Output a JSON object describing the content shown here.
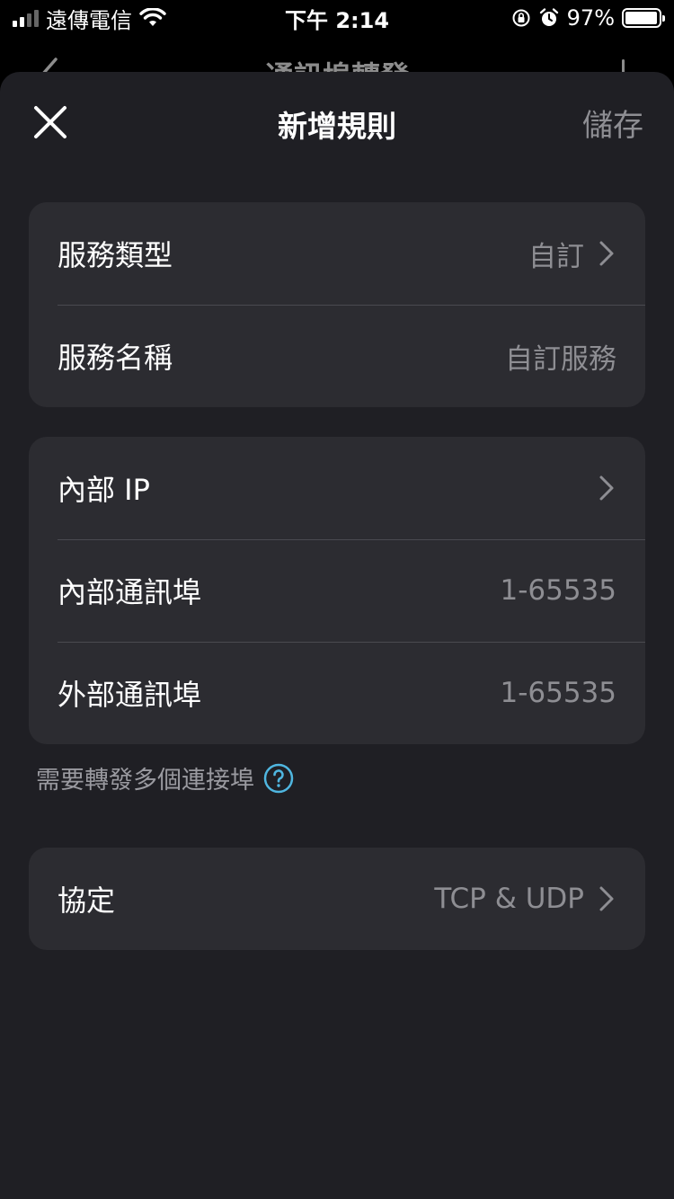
{
  "status_bar": {
    "carrier": "遠傳電信",
    "time": "下午 2:14",
    "battery_percent": "97%",
    "battery_level": 0.97
  },
  "background_page": {
    "title": "通訊埠轉發"
  },
  "sheet": {
    "title": "新增規則",
    "save_label": "儲存"
  },
  "service_group": {
    "type_label": "服務類型",
    "type_value": "自訂",
    "name_label": "服務名稱",
    "name_placeholder": "自訂服務"
  },
  "ip_group": {
    "internal_ip_label": "內部 IP",
    "internal_port_label": "內部通訊埠",
    "internal_port_placeholder": "1-65535",
    "external_port_label": "外部通訊埠",
    "external_port_placeholder": "1-65535"
  },
  "hint": {
    "text": "需要轉發多個連接埠"
  },
  "protocol_group": {
    "label": "協定",
    "value": "TCP & UDP"
  },
  "colors": {
    "sheet_bg": "#1f1f24",
    "card_bg": "#2c2c31",
    "secondary_text": "#8e8e93",
    "help_icon": "#4fb6e0"
  }
}
